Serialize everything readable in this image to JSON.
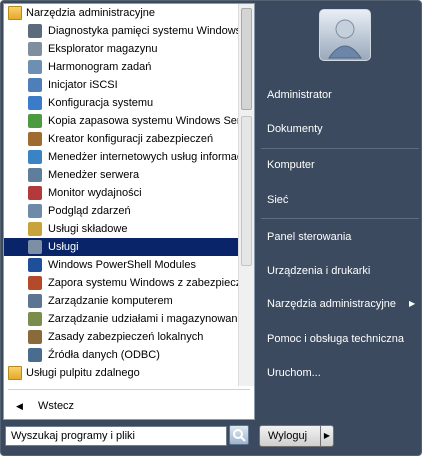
{
  "programs": [
    {
      "label": "Narzędzia administracyjne",
      "type": "folder",
      "color": "#e5a92b"
    },
    {
      "label": "Diagnostyka pamięci systemu Windows",
      "type": "app",
      "color": "#5b6b7d"
    },
    {
      "label": "Eksplorator magazynu",
      "type": "app",
      "color": "#7f8f9f"
    },
    {
      "label": "Harmonogram zadań",
      "type": "app",
      "color": "#6c8fb2"
    },
    {
      "label": "Inicjator iSCSI",
      "type": "app",
      "color": "#4e7fb8"
    },
    {
      "label": "Konfiguracja systemu",
      "type": "app",
      "color": "#3b7bc8"
    },
    {
      "label": "Kopia zapasowa systemu Windows Serv",
      "type": "app",
      "color": "#4c9a3f"
    },
    {
      "label": "Kreator konfiguracji zabezpieczeń",
      "type": "app",
      "color": "#a06b2e"
    },
    {
      "label": "Menedżer internetowych usług informac",
      "type": "app",
      "color": "#3a83c4"
    },
    {
      "label": "Menedżer serwera",
      "type": "app",
      "color": "#5e7e9c"
    },
    {
      "label": "Monitor wydajności",
      "type": "app",
      "color": "#b23a3a"
    },
    {
      "label": "Podgląd zdarzeń",
      "type": "app",
      "color": "#6f8aa8"
    },
    {
      "label": "Usługi składowe",
      "type": "app",
      "color": "#c8a23a"
    },
    {
      "label": "Usługi",
      "type": "app",
      "color": "#7d8fa4",
      "selected": true
    },
    {
      "label": "Windows PowerShell Modules",
      "type": "app",
      "color": "#1f4f9a"
    },
    {
      "label": "Zapora systemu Windows z zabezpiecze",
      "type": "app",
      "color": "#b54a2a"
    },
    {
      "label": "Zarządzanie komputerem",
      "type": "app",
      "color": "#5c7592"
    },
    {
      "label": "Zarządzanie udziałami i magazynowanie",
      "type": "app",
      "color": "#7b8d4a"
    },
    {
      "label": "Zasady zabezpieczeń lokalnych",
      "type": "app",
      "color": "#8a6a3a"
    },
    {
      "label": "Źródła danych (ODBC)",
      "type": "app",
      "color": "#4a6d8f"
    },
    {
      "label": "Usługi pulpitu zdalnego",
      "type": "folder",
      "color": "#e5a92b"
    }
  ],
  "back_label": "Wstecz",
  "search": {
    "placeholder": "Wyszukaj programy i pliki"
  },
  "right_items": [
    "Administrator",
    "Dokumenty",
    "Komputer",
    "Sieć",
    "Panel sterowania",
    "Urządzenia i drukarki",
    "Narzędzia administracyjne",
    "Pomoc i obsługa techniczna",
    "Uruchom..."
  ],
  "shutdown_label": "Wyloguj",
  "colors": {
    "selected": "#0a246a",
    "panel": "#3b4a5e"
  }
}
